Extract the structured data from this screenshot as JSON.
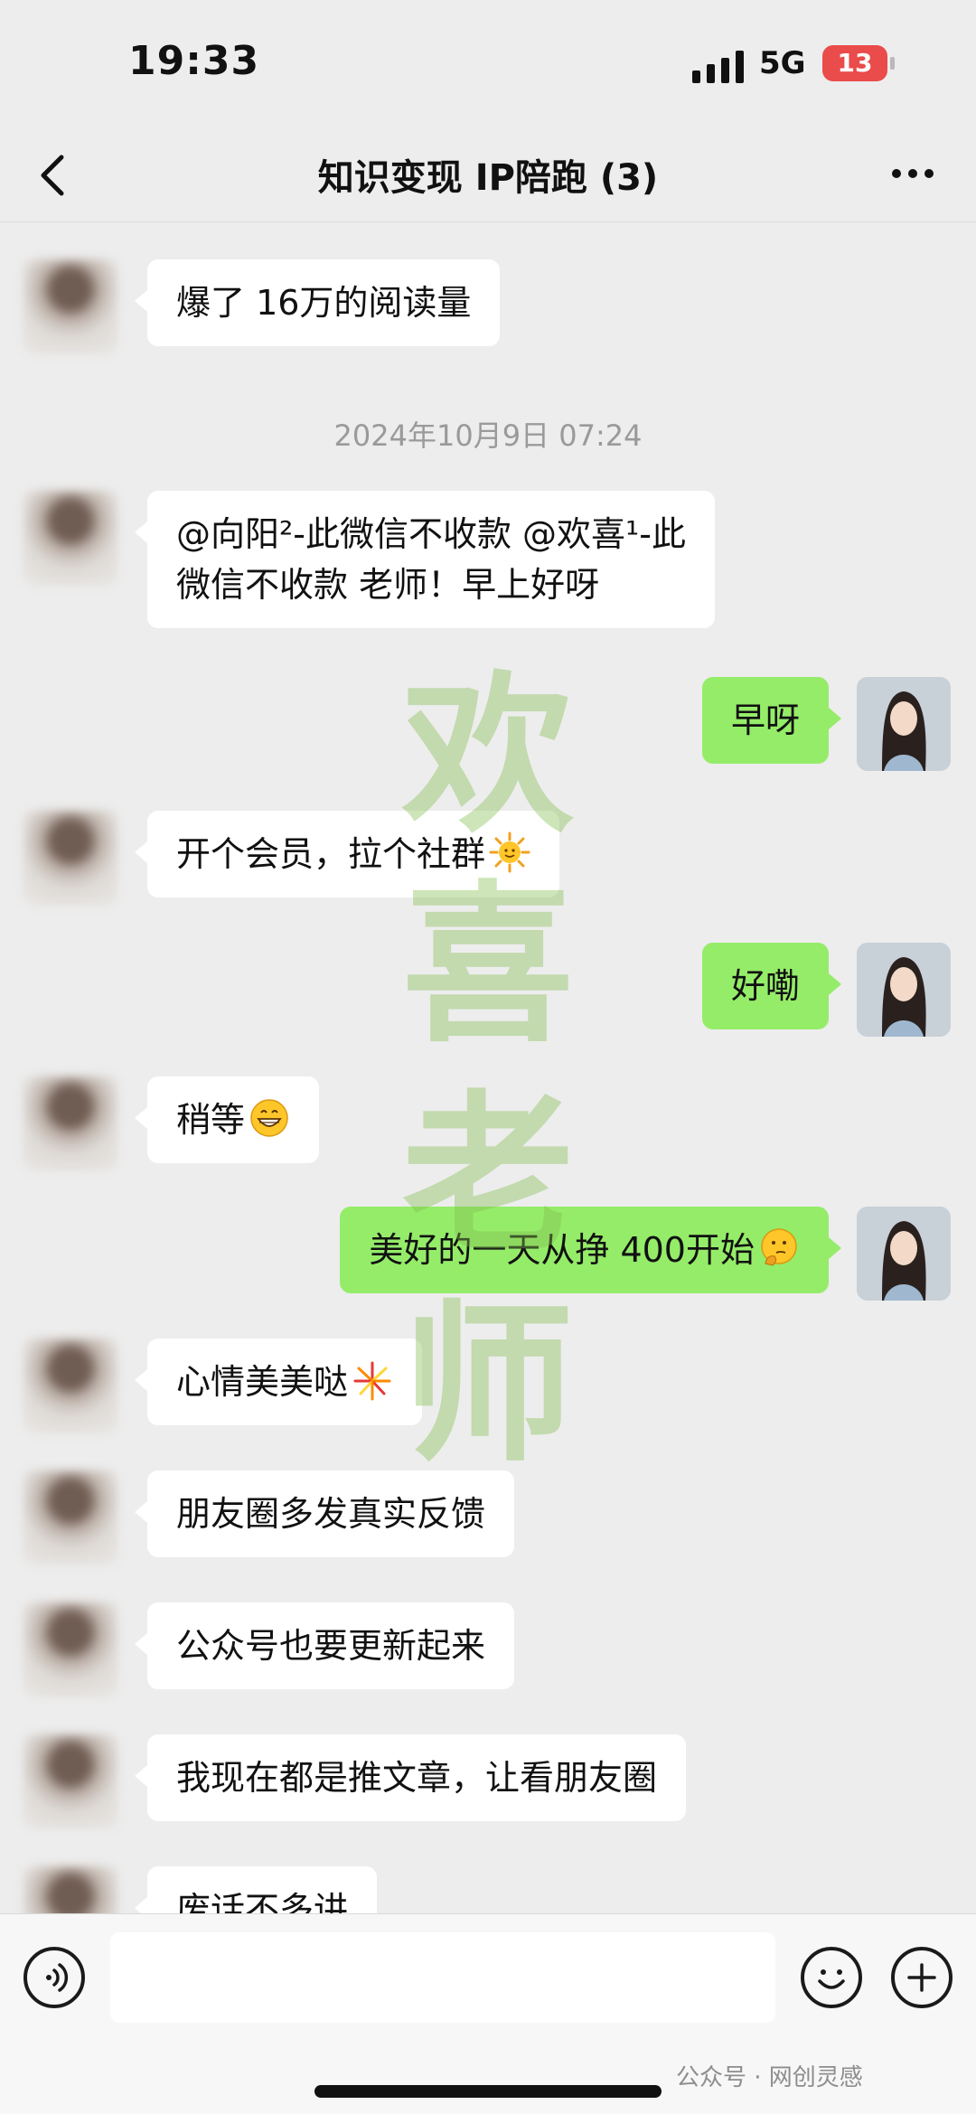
{
  "status_bar": {
    "time": "19:33",
    "network": "5G",
    "battery": "13"
  },
  "header": {
    "title": "知识变现 IP陪跑 (3)"
  },
  "messages": [
    {
      "side": "left",
      "text": "爆了 16万的阅读量"
    },
    {
      "type": "timestamp",
      "text": "2024年10月9日 07:24"
    },
    {
      "side": "left",
      "text": "@向阳²-此微信不收款 @欢喜¹-此\n微信不收款 老师！早上好呀"
    },
    {
      "side": "right",
      "text": "早呀"
    },
    {
      "side": "left",
      "text": "开个会员，拉个社群",
      "emoji": "sun"
    },
    {
      "side": "right",
      "text": "好嘞"
    },
    {
      "side": "left",
      "text": "稍等",
      "emoji": "grin"
    },
    {
      "side": "right",
      "text": "美好的一天从挣 400开始",
      "emoji": "thinking"
    },
    {
      "side": "left",
      "text": "心情美美哒",
      "emoji": "fireworks"
    },
    {
      "side": "left",
      "text": "朋友圈多发真实反馈"
    },
    {
      "side": "left",
      "text": "公众号也要更新起来"
    },
    {
      "side": "left",
      "text": "我现在都是推文章，让看朋友圈"
    },
    {
      "side": "left",
      "text": "废话不多讲"
    }
  ],
  "watermark": [
    "欢",
    "喜",
    "老",
    "师"
  ],
  "footer_mark": "公众号 · 网创灵感",
  "icons": {
    "back": "chevron-left-icon",
    "more": "more-dots-icon",
    "voice": "voice-icon",
    "emoji": "smiley-icon",
    "plus": "plus-icon"
  }
}
